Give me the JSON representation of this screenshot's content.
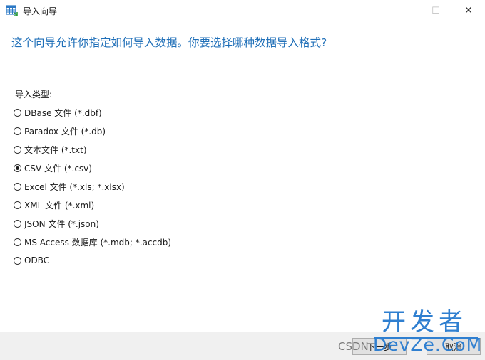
{
  "window": {
    "title": "导入向导",
    "minimize_glyph": "—",
    "maximize_glyph": "☐",
    "close_glyph": "✕"
  },
  "heading": "这个向导允许你指定如何导入数据。你要选择哪种数据导入格式?",
  "import_type_label": "导入类型:",
  "options": [
    {
      "label": "DBase 文件 (*.dbf)",
      "selected": false
    },
    {
      "label": "Paradox 文件 (*.db)",
      "selected": false
    },
    {
      "label": "文本文件 (*.txt)",
      "selected": false
    },
    {
      "label": "CSV 文件 (*.csv)",
      "selected": true
    },
    {
      "label": "Excel 文件 (*.xls; *.xlsx)",
      "selected": false
    },
    {
      "label": "XML 文件 (*.xml)",
      "selected": false
    },
    {
      "label": "JSON 文件 (*.json)",
      "selected": false
    },
    {
      "label": "MS Access 数据库 (*.mdb; *.accdb)",
      "selected": false
    },
    {
      "label": "ODBC",
      "selected": false
    }
  ],
  "buttons": {
    "next": "下一步",
    "cancel": "取消"
  },
  "watermark": {
    "logo": "开发者",
    "csdn": "CSDN",
    "site": "DevZe.CoM"
  },
  "colors": {
    "heading": "#1f6fb8",
    "watermark": "#2f7fd0"
  }
}
